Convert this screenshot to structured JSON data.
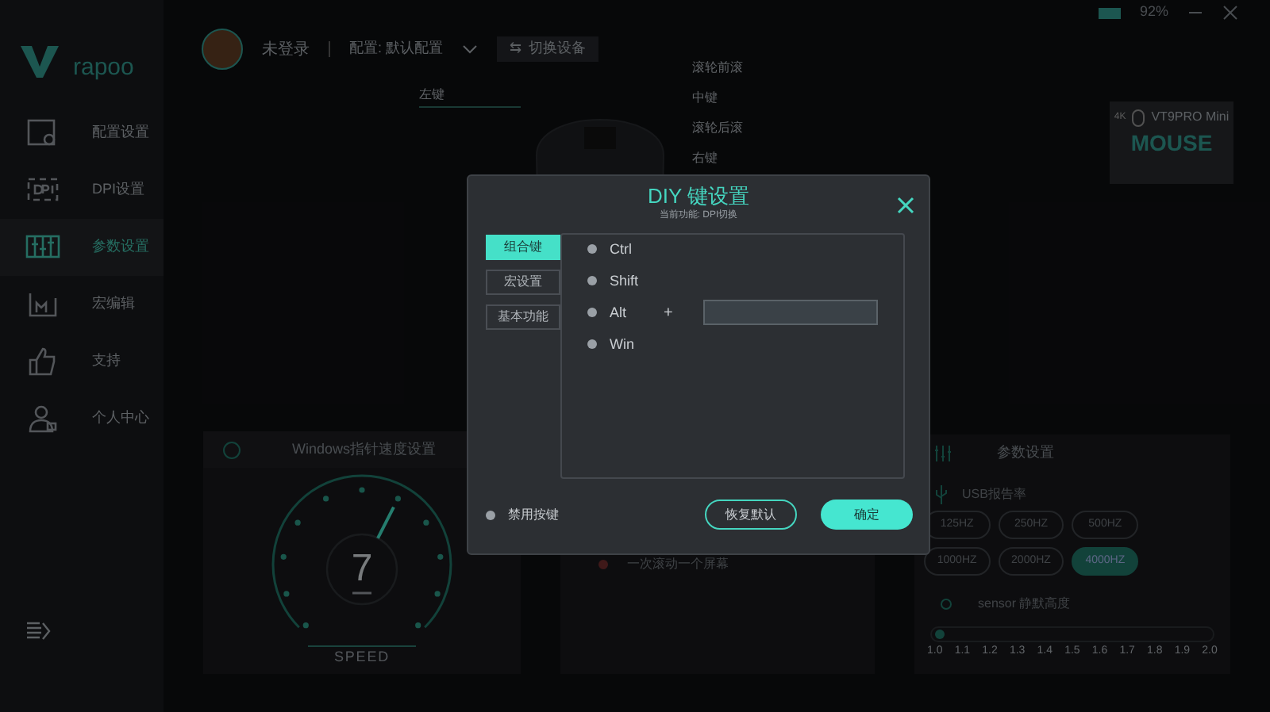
{
  "title_bar": {
    "battery": "92%"
  },
  "brand": {
    "logo_text": "rapoo"
  },
  "sidebar": {
    "items": [
      {
        "label": "配置设置",
        "selected": false
      },
      {
        "label": "DPI设置",
        "selected": false
      },
      {
        "label": "参数设置",
        "selected": true
      },
      {
        "label": "宏编辑",
        "selected": false
      },
      {
        "label": "支持",
        "selected": false
      },
      {
        "label": "个人中心",
        "selected": false
      }
    ]
  },
  "header": {
    "user": "未登录",
    "profile": "配置: 默认配置",
    "switch_icon": "⇆",
    "switch_device": "切换设备"
  },
  "mouse_labels": [
    "左键",
    "滚轮前滚",
    "中键",
    "滚轮后滚",
    "右键"
  ],
  "device_card": {
    "badge": "4K",
    "model": "VT9PRO Mini",
    "type": "MOUSE"
  },
  "pointer_panel": {
    "title": "Windows指针速度设置",
    "value": "7",
    "gauge_label": "SPEED",
    "level": 0.6
  },
  "scroll_panel": {
    "options": [
      "一次滚动一个屏幕"
    ]
  },
  "params_panel": {
    "title": "参数设置",
    "usb_label": "USB报告率",
    "rates": [
      {
        "label": "125HZ",
        "selected": false
      },
      {
        "label": "250HZ",
        "selected": false
      },
      {
        "label": "500HZ",
        "selected": false
      },
      {
        "label": "1000HZ",
        "selected": false
      },
      {
        "label": "2000HZ",
        "selected": false
      },
      {
        "label": "4000HZ",
        "selected": true
      }
    ],
    "sensor_label": "sensor 静默高度",
    "slider": {
      "level": 0,
      "ticks": [
        "1.0",
        "1.1",
        "1.2",
        "1.3",
        "1.4",
        "1.5",
        "1.6",
        "1.7",
        "1.8",
        "1.9",
        "2.0"
      ]
    }
  },
  "dialog": {
    "title": "DIY 键设置",
    "subtitle": "当前功能: DPI切换",
    "tabs": [
      {
        "label": "组合键",
        "selected": true
      },
      {
        "label": "宏设置",
        "selected": false
      },
      {
        "label": "基本功能",
        "selected": false
      }
    ],
    "modifiers": [
      {
        "label": "Ctrl",
        "selected": false
      },
      {
        "label": "Shift",
        "selected": false
      },
      {
        "label": "Alt",
        "selected": false
      },
      {
        "label": "Win",
        "selected": false
      }
    ],
    "plus": "+",
    "disable_key": {
      "label": "禁用按键",
      "checked": false
    },
    "reset_button": "恢复默认",
    "ok_button": "确定"
  }
}
